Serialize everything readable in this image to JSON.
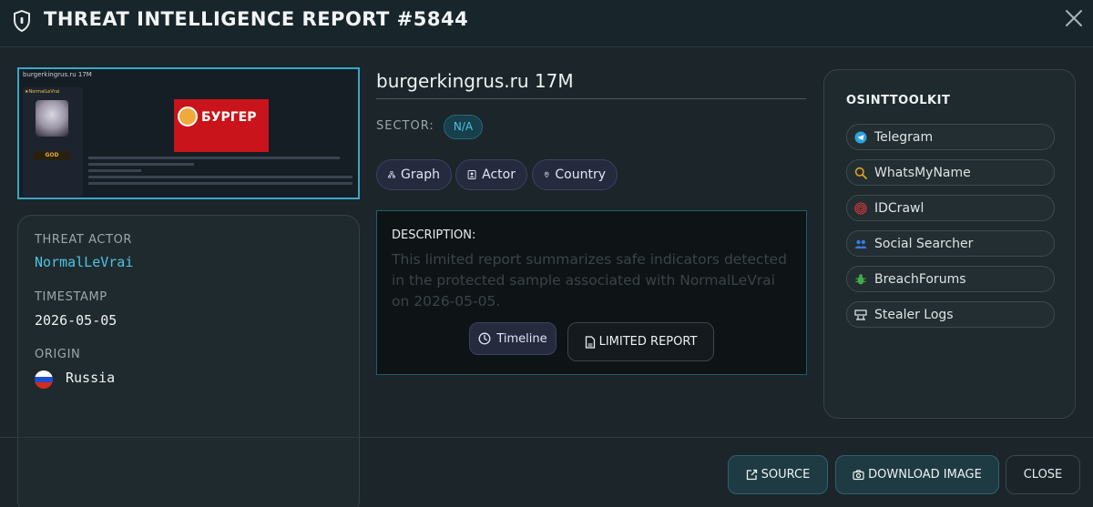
{
  "window": {
    "title": "THREAT INTELLIGENCE REPORT #5844"
  },
  "thumbnail": {
    "header": "burgerkingrus.ru 17M",
    "username": "★NormalLeVrai",
    "rank": "GOD",
    "banner_text": "БУРГЕР"
  },
  "info": {
    "threat_actor_label": "THREAT ACTOR",
    "threat_actor": "NormalLeVrai",
    "timestamp_label": "TIMESTAMP",
    "timestamp": "2026-05-05",
    "origin_label": "ORIGIN",
    "origin": "Russia",
    "flag_colors": [
      "#ffffff",
      "#1f4fd1",
      "#d52b1e"
    ]
  },
  "report": {
    "headline": "burgerkingrus.ru 17M",
    "sector_label": "SECTOR:",
    "sector_value": "N/A",
    "chips": [
      {
        "label": "Graph",
        "icon": "graph-icon"
      },
      {
        "label": "Actor",
        "icon": "actor-icon"
      },
      {
        "label": "Country",
        "icon": "location-pin-icon"
      }
    ],
    "description_label": "DESCRIPTION:",
    "description_text": "This limited report summarizes safe indicators detected in the protected sample associated with NormalLeVrai on 2026-05-05.",
    "timeline_label": "Timeline",
    "limited_report_label": "LIMITED REPORT"
  },
  "toolkit": {
    "title": "OSINTTOOLKIT",
    "tools": [
      {
        "label": "Telegram",
        "icon": "telegram-icon",
        "color": "#2aa3de"
      },
      {
        "label": "WhatsMyName",
        "icon": "search-icon",
        "color": "#e0a020"
      },
      {
        "label": "IDCrawl",
        "icon": "fingerprint-icon",
        "color": "#e03a3a"
      },
      {
        "label": "Social Searcher",
        "icon": "users-icon",
        "color": "#3a7ae0"
      },
      {
        "label": "BreachForums",
        "icon": "bug-icon",
        "color": "#3fae4a"
      },
      {
        "label": "Stealer Logs",
        "icon": "terminal-icon",
        "color": "#e6ecee"
      }
    ]
  },
  "footer": {
    "source_label": "SOURCE",
    "download_label": "DOWNLOAD IMAGE",
    "close_label": "CLOSE"
  },
  "colors": {
    "accent": "#4fc3e0",
    "background": "#1b252a"
  }
}
